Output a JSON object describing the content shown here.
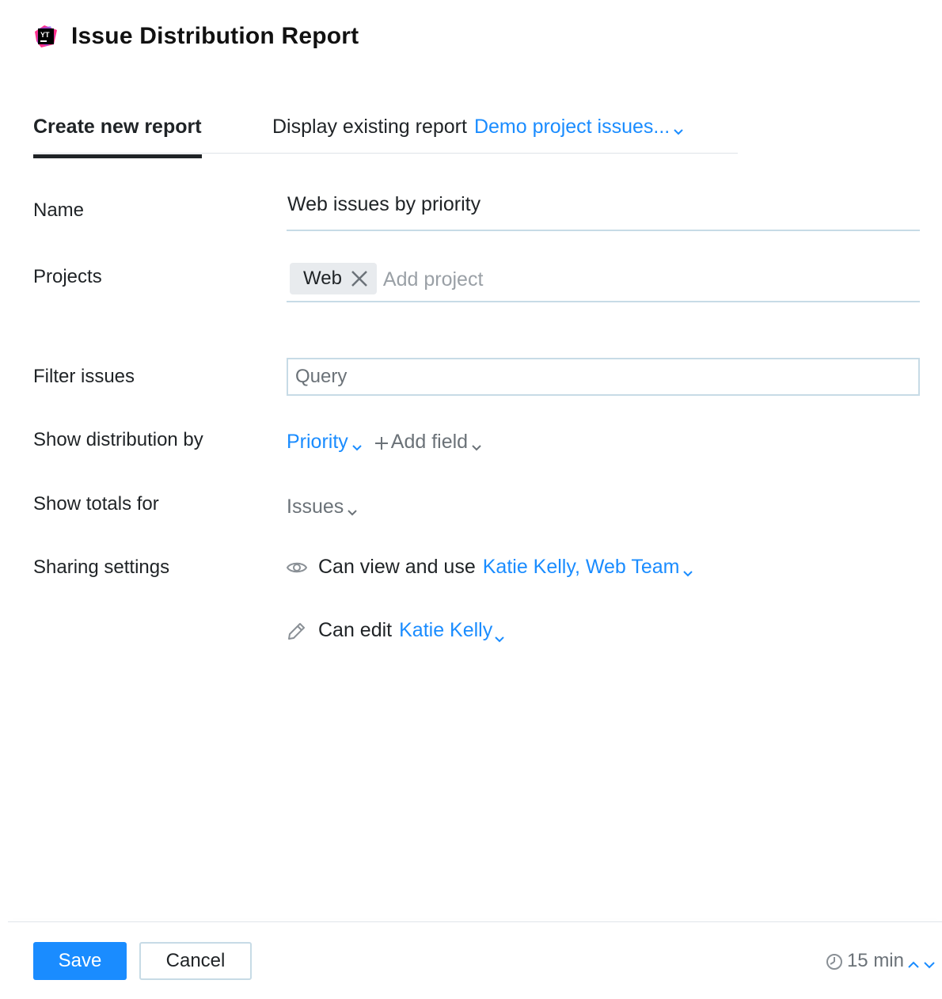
{
  "header": {
    "title": "Issue Distribution Report",
    "logo_text": "YT"
  },
  "tabs": {
    "create_label": "Create new report",
    "existing_prefix": "Display existing report",
    "existing_value": "Demo project issues..."
  },
  "form": {
    "name_label": "Name",
    "name_value": "Web issues by priority",
    "projects_label": "Projects",
    "project_chip": "Web",
    "add_project_placeholder": "Add project",
    "filter_label": "Filter issues",
    "query_placeholder": "Query",
    "distribution_label": "Show distribution by",
    "distribution_value": "Priority",
    "add_field_label": "Add field",
    "totals_label": "Show totals for",
    "totals_value": "Issues",
    "sharing_label": "Sharing settings",
    "view_prefix": "Can view and use",
    "view_value": "Katie Kelly, Web Team",
    "edit_prefix": "Can edit",
    "edit_value": "Katie Kelly"
  },
  "footer": {
    "save_label": "Save",
    "cancel_label": "Cancel",
    "timer_value": "15 min"
  },
  "colors": {
    "accent": "#1a8cff",
    "text": "#1f2326",
    "muted": "#6b7278",
    "border": "#c7dbe6"
  },
  "icons": [
    "youtrack-logo-icon",
    "chevron-down-icon",
    "close-icon",
    "plus-icon",
    "eye-icon",
    "pencil-icon",
    "timer-icon",
    "chevron-up-icon"
  ]
}
